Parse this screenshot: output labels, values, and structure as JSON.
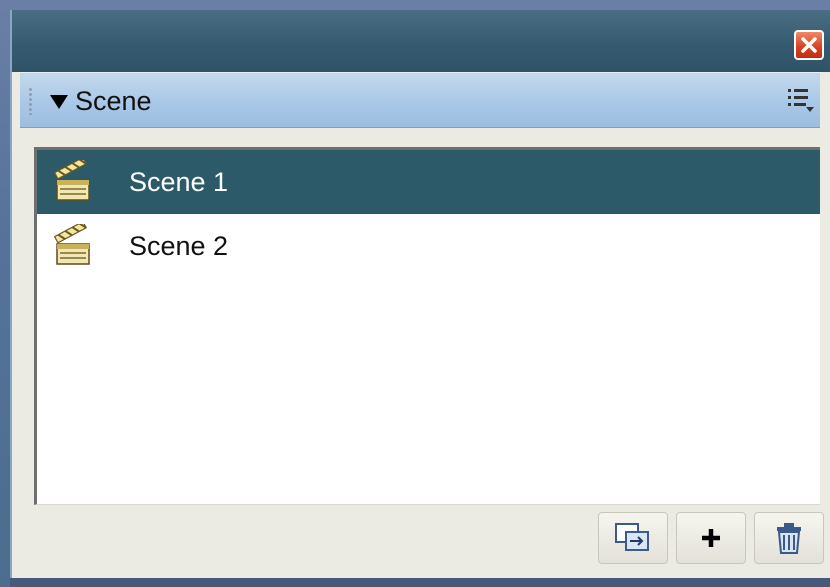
{
  "panel": {
    "title": "Scene"
  },
  "scenes": [
    {
      "label": "Scene 1",
      "selected": true
    },
    {
      "label": "Scene 2",
      "selected": false
    }
  ],
  "toolbar": {
    "buttons": [
      {
        "name": "duplicate-scene-button",
        "icon": "duplicate-icon"
      },
      {
        "name": "add-scene-button",
        "icon": "plus-icon"
      },
      {
        "name": "delete-scene-button",
        "icon": "trash-icon"
      }
    ]
  },
  "colors": {
    "titlebar": "#355a70",
    "header": "#a9c8e8",
    "selected_row": "#2d5a69",
    "close_button": "#d64020"
  }
}
